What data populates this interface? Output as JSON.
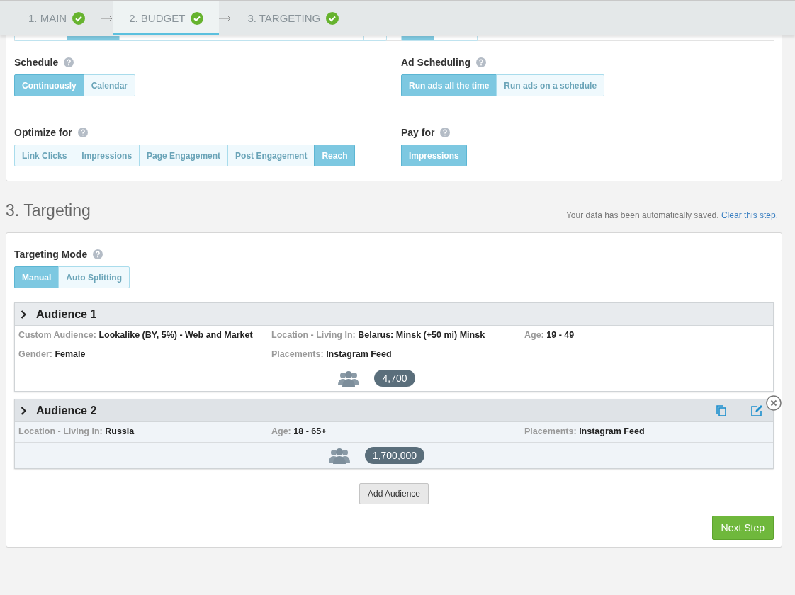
{
  "steps": [
    {
      "label": "1. MAIN",
      "done": true,
      "selected": false
    },
    {
      "label": "2. BUDGET",
      "done": true,
      "selected": true
    },
    {
      "label": "3. TARGETING",
      "done": true,
      "selected": false
    }
  ],
  "budget_fields": [
    {
      "label": "Schedule",
      "options": [
        {
          "label": "Continuously",
          "selected": true
        },
        {
          "label": "Calendar",
          "selected": false
        }
      ]
    },
    {
      "label": "Ad Scheduling",
      "options": [
        {
          "label": "Run ads all the time",
          "selected": true
        },
        {
          "label": "Run ads on a schedule",
          "selected": false
        }
      ]
    },
    {
      "label": "Optimize for",
      "options": [
        {
          "label": "Link Clicks",
          "selected": false
        },
        {
          "label": "Impressions",
          "selected": false
        },
        {
          "label": "Page Engagement",
          "selected": false
        },
        {
          "label": "Post Engagement",
          "selected": false
        },
        {
          "label": "Reach",
          "selected": true
        }
      ]
    },
    {
      "label": "Pay for",
      "options": [
        {
          "label": "Impressions",
          "selected": true
        }
      ]
    }
  ],
  "targeting": {
    "title": "3. Targeting",
    "save_note": "Your data has been automatically saved.",
    "clear_link": "Clear this step.",
    "mode": {
      "label": "Targeting Mode",
      "options": [
        {
          "label": "Manual",
          "selected": true
        },
        {
          "label": "Auto Splitting",
          "selected": false
        }
      ]
    },
    "audiences": [
      {
        "title": "Audience 1",
        "highlighted": false,
        "reach": "4,700",
        "fields": [
          {
            "label": "Custom Audience:",
            "value": "Lookalike (BY, 5%) - Web and Market"
          },
          {
            "label": "Location - Living In:",
            "value": "Belarus: Minsk (+50 mi) Minsk"
          },
          {
            "label": "Age:",
            "value": "19 - 49"
          },
          {
            "label": "Gender:",
            "value": "Female"
          },
          {
            "label": "Placements:",
            "value": "Instagram Feed"
          }
        ]
      },
      {
        "title": "Audience 2",
        "highlighted": true,
        "reach": "1,700,000",
        "fields": [
          {
            "label": "Location - Living In:",
            "value": "Russia"
          },
          {
            "label": "Age:",
            "value": "18 - 65+"
          },
          {
            "label": "Placements:",
            "value": "Instagram Feed"
          }
        ]
      }
    ],
    "add_button": "Add Audience"
  },
  "next_button": "Next Step"
}
